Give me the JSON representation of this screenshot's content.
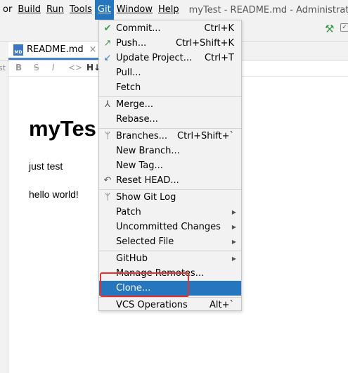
{
  "menubar": {
    "items": [
      "or",
      "Build",
      "Run",
      "Tools",
      "Git",
      "Window",
      "Help"
    ],
    "window_title": "myTest - README.md - Administrato"
  },
  "tab": {
    "label": "README.md",
    "close": "×",
    "icon_text": "MD"
  },
  "gutter": {
    "text": "st"
  },
  "md_toolbar": {
    "bold": "B",
    "strike": "S",
    "italic": "I",
    "code": "<>",
    "heading": "H↓"
  },
  "preview": {
    "heading": "myTes",
    "p1": "just test",
    "p2": "hello world!"
  },
  "git_menu": {
    "items": [
      {
        "label": "Commit...",
        "shortcut": "Ctrl+K",
        "icon": "check-icon"
      },
      {
        "label": "Push...",
        "shortcut": "Ctrl+Shift+K",
        "icon": "push-arrow-icon"
      },
      {
        "label": "Update Project...",
        "shortcut": "Ctrl+T",
        "icon": "update-arrow-icon"
      },
      {
        "label": "Pull...",
        "shortcut": ""
      },
      {
        "label": "Fetch",
        "shortcut": ""
      },
      {
        "label": "Merge...",
        "icon": "merge-icon"
      },
      {
        "label": "Rebase..."
      },
      {
        "label": "Branches...",
        "shortcut": "Ctrl+Shift+`",
        "icon": "branch-icon"
      },
      {
        "label": "New Branch..."
      },
      {
        "label": "New Tag..."
      },
      {
        "label": "Reset HEAD...",
        "icon": "undo-icon"
      },
      {
        "label": "Show Git Log",
        "icon": "git-log-icon"
      },
      {
        "label": "Patch",
        "submenu": true
      },
      {
        "label": "Uncommitted Changes",
        "submenu": true
      },
      {
        "label": "Selected File",
        "submenu": true
      },
      {
        "label": "GitHub",
        "submenu": true
      },
      {
        "label": "Manage Remotes..."
      },
      {
        "label": "Clone...",
        "selected": true
      },
      {
        "label": "VCS Operations",
        "shortcut": "Alt+`"
      }
    ]
  },
  "colors": {
    "menu_highlight": "#2675bf",
    "annotation": "#e5322d",
    "commit_check": "#3d9a50",
    "arrow_blue": "#3c78c3"
  }
}
